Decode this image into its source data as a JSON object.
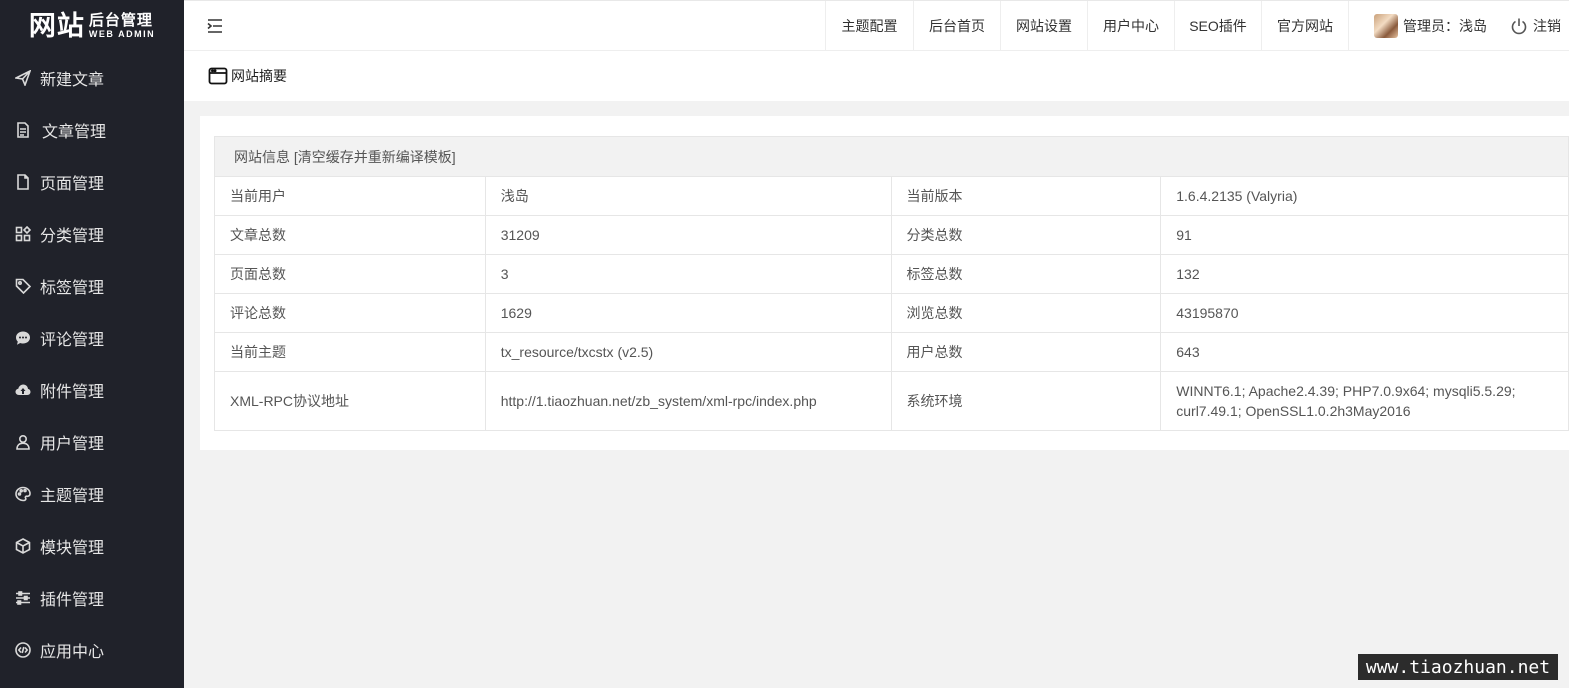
{
  "brand": {
    "big": "网站",
    "cn": "后台管理",
    "en": "WEB ADMIN"
  },
  "sidebar": {
    "items": [
      {
        "label": "新建文章",
        "icon": "paper-plane-icon"
      },
      {
        "label": "文章管理",
        "icon": "document-icon"
      },
      {
        "label": "页面管理",
        "icon": "file-icon"
      },
      {
        "label": "分类管理",
        "icon": "category-grid-icon"
      },
      {
        "label": "标签管理",
        "icon": "tag-icon"
      },
      {
        "label": "评论管理",
        "icon": "chat-bubble-icon"
      },
      {
        "label": "附件管理",
        "icon": "cloud-upload-icon"
      },
      {
        "label": "用户管理",
        "icon": "user-icon"
      },
      {
        "label": "主题管理",
        "icon": "palette-icon"
      },
      {
        "label": "模块管理",
        "icon": "cube-icon"
      },
      {
        "label": "插件管理",
        "icon": "sliders-icon"
      },
      {
        "label": "应用中心",
        "icon": "code-circle-icon"
      }
    ]
  },
  "topnav": {
    "items": [
      "主题配置",
      "后台首页",
      "网站设置",
      "用户中心",
      "SEO插件",
      "官方网站"
    ],
    "user_label": "管理员：浅岛",
    "logout_label": "注销"
  },
  "page": {
    "title": "网站摘要"
  },
  "info": {
    "header": "网站信息 [清空缓存并重新编译模板]",
    "rows": [
      [
        "当前用户",
        "浅岛",
        "当前版本",
        "1.6.4.2135 (Valyria)"
      ],
      [
        "文章总数",
        "31209",
        "分类总数",
        "91"
      ],
      [
        "页面总数",
        "3",
        "标签总数",
        "132"
      ],
      [
        "评论总数",
        "1629",
        "浏览总数",
        "43195870"
      ],
      [
        "当前主题",
        "tx_resource/txcstx (v2.5)",
        "用户总数",
        "643"
      ],
      [
        "XML-RPC协议地址",
        "http://1.tiaozhuan.net/zb_system/xml-rpc/index.php",
        "系统环境",
        "WINNT6.1; Apache2.4.39; PHP7.0.9x64; mysqli5.5.29; curl7.49.1; OpenSSL1.0.2h3May2016"
      ]
    ]
  },
  "watermark": "www.tiaozhuan.net",
  "colors": {
    "sidebar_bg": "#20222a",
    "page_bg": "#f2f2f2",
    "table_header_bg": "#f2f2f2"
  }
}
